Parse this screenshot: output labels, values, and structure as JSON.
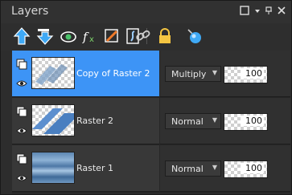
{
  "panel": {
    "title": "Layers"
  },
  "toolbar": {
    "tools": [
      {
        "name": "move-layer-up-icon"
      },
      {
        "name": "move-layer-down-icon"
      },
      {
        "name": "new-mask-layer-icon"
      },
      {
        "name": "effects-icon"
      },
      {
        "name": "adjustment-icon"
      },
      {
        "name": "link-icon"
      },
      {
        "name": "lock-icon"
      },
      {
        "name": "properties-icon"
      }
    ]
  },
  "layers": [
    {
      "name": "Copy of Raster 2",
      "blend": "Multiply",
      "opacity": "100",
      "selected": true
    },
    {
      "name": "Raster 2",
      "blend": "Normal",
      "opacity": "100",
      "selected": false
    },
    {
      "name": "Raster 1",
      "blend": "Normal",
      "opacity": "100",
      "selected": false
    }
  ],
  "colors": {
    "selection": "#3d94f6",
    "background": "#2d2d2d"
  }
}
